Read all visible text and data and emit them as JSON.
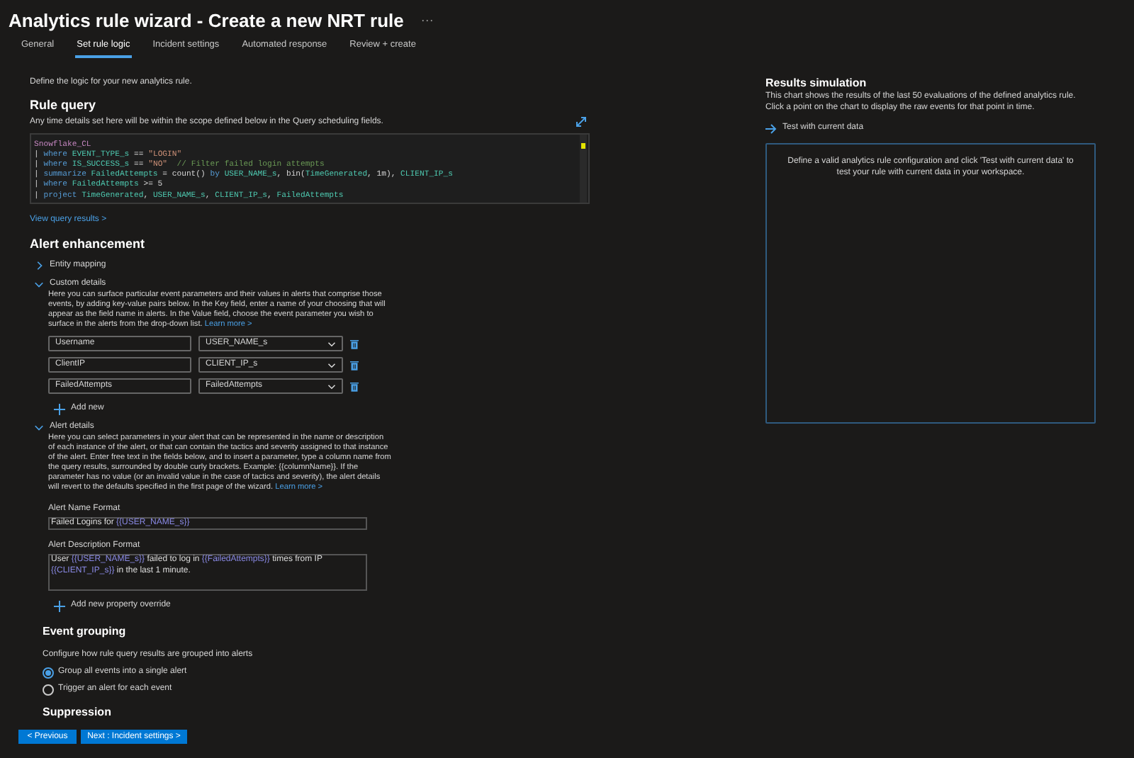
{
  "window": {
    "title": "Analytics rule wizard - Create a new NRT rule",
    "more": "···"
  },
  "tabs": [
    {
      "label": "General",
      "selected": false
    },
    {
      "label": "Set rule logic",
      "selected": true
    },
    {
      "label": "Incident settings",
      "selected": false
    },
    {
      "label": "Automated response",
      "selected": false
    },
    {
      "label": "Review + create",
      "selected": false
    }
  ],
  "intro": "Define the logic for your new analytics rule.",
  "rule_query": {
    "heading": "Rule query",
    "description": "Any time details set here will be within the scope defined below in the Query scheduling fields.",
    "code_lines": [
      [
        {
          "kind": "table",
          "text": "Snowflake_CL"
        }
      ],
      [
        {
          "kind": "pipe",
          "text": "| "
        },
        {
          "kind": "keyword",
          "text": "where "
        },
        {
          "kind": "ident",
          "text": "EVENT_TYPE_s"
        },
        {
          "kind": "plain",
          "text": " == "
        },
        {
          "kind": "string",
          "text": "\"LOGIN\""
        }
      ],
      [
        {
          "kind": "pipe",
          "text": "| "
        },
        {
          "kind": "keyword",
          "text": "where "
        },
        {
          "kind": "ident",
          "text": "IS_SUCCESS_s"
        },
        {
          "kind": "plain",
          "text": " == "
        },
        {
          "kind": "string",
          "text": "\"NO\""
        },
        {
          "kind": "comment",
          "text": "  // Filter failed login attempts"
        }
      ],
      [
        {
          "kind": "pipe",
          "text": "| "
        },
        {
          "kind": "keyword",
          "text": "summarize "
        },
        {
          "kind": "ident",
          "text": "FailedAttempts"
        },
        {
          "kind": "plain",
          "text": " = count() "
        },
        {
          "kind": "keyword",
          "text": "by "
        },
        {
          "kind": "ident",
          "text": "USER_NAME_s"
        },
        {
          "kind": "plain",
          "text": ", bin("
        },
        {
          "kind": "ident",
          "text": "TimeGenerated"
        },
        {
          "kind": "plain",
          "text": ", 1m), "
        },
        {
          "kind": "ident",
          "text": "CLIENT_IP_s"
        }
      ],
      [
        {
          "kind": "pipe",
          "text": "| "
        },
        {
          "kind": "keyword",
          "text": "where "
        },
        {
          "kind": "ident",
          "text": "FailedAttempts"
        },
        {
          "kind": "plain",
          "text": " >= 5"
        }
      ],
      [
        {
          "kind": "pipe",
          "text": "| "
        },
        {
          "kind": "keyword",
          "text": "project "
        },
        {
          "kind": "ident",
          "text": "TimeGenerated"
        },
        {
          "kind": "plain",
          "text": ", "
        },
        {
          "kind": "ident",
          "text": "USER_NAME_s"
        },
        {
          "kind": "plain",
          "text": ", "
        },
        {
          "kind": "ident",
          "text": "CLIENT_IP_s"
        },
        {
          "kind": "plain",
          "text": ", "
        },
        {
          "kind": "ident",
          "text": "FailedAttempts"
        }
      ]
    ],
    "view_results": "View query results >"
  },
  "alert_enhancement": {
    "heading": "Alert enhancement",
    "sections": [
      {
        "kind": "plain",
        "label": "Entity mapping",
        "expanded": false
      },
      {
        "kind": "custom",
        "label": "Custom details",
        "expanded": true,
        "description": "Here you can surface particular event parameters and their values in alerts that comprise those events, by adding key-value pairs below. In the Key field, enter a name of your choosing that will appear as the field name in alerts. In the Value field, choose the event parameter you wish to surface in the alerts from the drop-down list.",
        "learn_more": "Learn more >",
        "pairs": [
          {
            "key": "Username",
            "value": "USER_NAME_s"
          },
          {
            "key": "ClientIP",
            "value": "CLIENT_IP_s"
          },
          {
            "key": "FailedAttempts",
            "value": "FailedAttempts"
          }
        ],
        "add": "Add new"
      },
      {
        "kind": "details",
        "label": "Alert details",
        "expanded": true,
        "description": "Here you can select parameters in your alert that can be represented in the name or description of each instance of the alert, or that can contain the tactics and severity assigned to that instance of the alert. Enter free text in the fields below, and to insert a parameter, type a column name from the query results, surrounded by double curly brackets. Example: {{columnName}}. If the parameter has no value (or an invalid value in the case of tactics and severity), the alert details will revert to the defaults specified in the first page of the wizard.",
        "learn_more": "Learn more >",
        "fields": [
          {
            "label": "Alert Name Format",
            "multiline": false,
            "value": [
              {
                "kind": "text",
                "text": "Failed Logins for "
              },
              {
                "kind": "param",
                "text": "{{USER_NAME_s}}"
              }
            ]
          },
          {
            "label": "Alert Description Format",
            "multiline": true,
            "value": [
              {
                "kind": "text",
                "text": "User "
              },
              {
                "kind": "param",
                "text": "{{USER_NAME_s}}"
              },
              {
                "kind": "text",
                "text": " failed to log in "
              },
              {
                "kind": "param",
                "text": "{{FailedAttempts}}"
              },
              {
                "kind": "text",
                "text": " times from IP "
              },
              {
                "kind": "param",
                "text": "{{CLIENT_IP_s}}"
              },
              {
                "kind": "text",
                "text": " in the last 1 minute."
              }
            ]
          }
        ],
        "add": "Add new property override"
      }
    ]
  },
  "event_grouping": {
    "heading": "Event grouping",
    "description": "Configure how rule query results are grouped into alerts",
    "options": [
      {
        "label": "Group all events into a single alert",
        "selected": true
      },
      {
        "label": "Trigger an alert for each event",
        "selected": false
      }
    ]
  },
  "suppression": {
    "heading": "Suppression"
  },
  "buttons": [
    "< Previous",
    "Next : Incident settings >"
  ],
  "results": {
    "heading": "Results simulation",
    "description": "This chart shows the results of the last 50 evaluations of the defined analytics rule. Click a point on the chart to display the raw events for that point in time.",
    "test_button": "Test with current data",
    "message": "Define a valid analytics rule configuration and click 'Test with current data' to test your rule with current data in your workspace."
  }
}
